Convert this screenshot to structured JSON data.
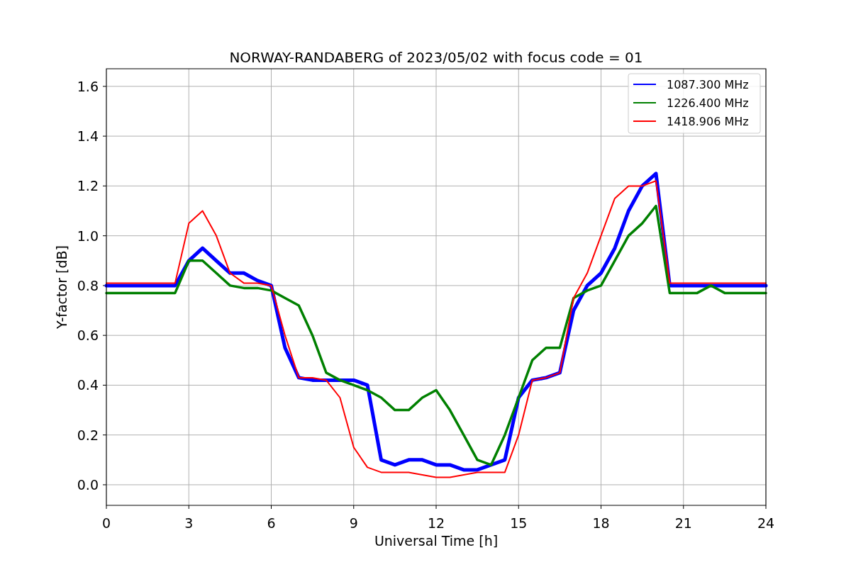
{
  "figure": {
    "chart_data": {
      "type": "line",
      "title": "NORWAY-RANDABERG of 2023/05/02 with focus code = 01",
      "xlabel": "Universal Time [h]",
      "ylabel": "Y-factor [dB]",
      "x": [
        0,
        0.5,
        1,
        1.5,
        2,
        2.5,
        3,
        3.5,
        4,
        4.5,
        5,
        5.5,
        6,
        6.5,
        7,
        7.5,
        8,
        8.5,
        9,
        9.5,
        10,
        10.5,
        11,
        11.5,
        12,
        12.5,
        13,
        13.5,
        14,
        14.5,
        15,
        15.5,
        16,
        16.5,
        17,
        17.5,
        18,
        18.5,
        19,
        19.5,
        20,
        20.5,
        21,
        21.5,
        22,
        22.5,
        23,
        23.5,
        24
      ],
      "series": [
        {
          "name": "1087.300 MHz",
          "color": "#0000ff",
          "values": [
            0.8,
            0.8,
            0.8,
            0.8,
            0.8,
            0.8,
            0.9,
            0.95,
            0.9,
            0.85,
            0.85,
            0.82,
            0.8,
            0.55,
            0.43,
            0.42,
            0.42,
            0.42,
            0.42,
            0.4,
            0.1,
            0.08,
            0.1,
            0.1,
            0.08,
            0.08,
            0.06,
            0.06,
            0.08,
            0.1,
            0.35,
            0.42,
            0.43,
            0.45,
            0.7,
            0.8,
            0.85,
            0.95,
            1.1,
            1.2,
            1.25,
            0.8,
            0.8,
            0.8,
            0.8,
            0.8,
            0.8,
            0.8,
            0.8
          ]
        },
        {
          "name": "1226.400 MHz",
          "color": "#008000",
          "values": [
            0.77,
            0.77,
            0.77,
            0.77,
            0.77,
            0.77,
            0.9,
            0.9,
            0.85,
            0.8,
            0.79,
            0.79,
            0.78,
            0.75,
            0.72,
            0.6,
            0.45,
            0.42,
            0.4,
            0.38,
            0.35,
            0.3,
            0.3,
            0.35,
            0.38,
            0.3,
            0.2,
            0.1,
            0.08,
            0.2,
            0.35,
            0.5,
            0.55,
            0.55,
            0.75,
            0.78,
            0.8,
            0.9,
            1.0,
            1.05,
            1.12,
            0.77,
            0.77,
            0.77,
            0.8,
            0.77,
            0.77,
            0.77,
            0.77
          ]
        },
        {
          "name": "1418.906 MHz",
          "color": "#ff0000",
          "values": [
            0.81,
            0.81,
            0.81,
            0.81,
            0.81,
            0.81,
            1.05,
            1.1,
            1.0,
            0.85,
            0.81,
            0.81,
            0.8,
            0.6,
            0.43,
            0.43,
            0.42,
            0.35,
            0.15,
            0.07,
            0.05,
            0.05,
            0.05,
            0.04,
            0.03,
            0.03,
            0.04,
            0.05,
            0.05,
            0.05,
            0.2,
            0.42,
            0.43,
            0.45,
            0.75,
            0.85,
            1.0,
            1.15,
            1.2,
            1.2,
            1.22,
            0.81,
            0.81,
            0.81,
            0.81,
            0.81,
            0.81,
            0.81,
            0.81
          ]
        }
      ],
      "grid": true,
      "legend": true,
      "xlim": [
        0,
        24
      ],
      "ylim": [
        -0.0826,
        1.6707
      ],
      "xticks": [
        0,
        3,
        6,
        9,
        12,
        15,
        18,
        21,
        24
      ],
      "yticks": [
        {
          "value": 0,
          "label": "0.0"
        },
        {
          "value": 0.2,
          "label": "0.2"
        },
        {
          "value": 0.4,
          "label": "0.4"
        },
        {
          "value": 0.6,
          "label": "0.6"
        },
        {
          "value": 0.8,
          "label": "0.8"
        },
        {
          "value": 1,
          "label": "1.0"
        },
        {
          "value": 1.2,
          "label": "1.2"
        },
        {
          "value": 1.4,
          "label": "1.4"
        },
        {
          "value": 1.6,
          "label": "1.6"
        }
      ]
    }
  }
}
